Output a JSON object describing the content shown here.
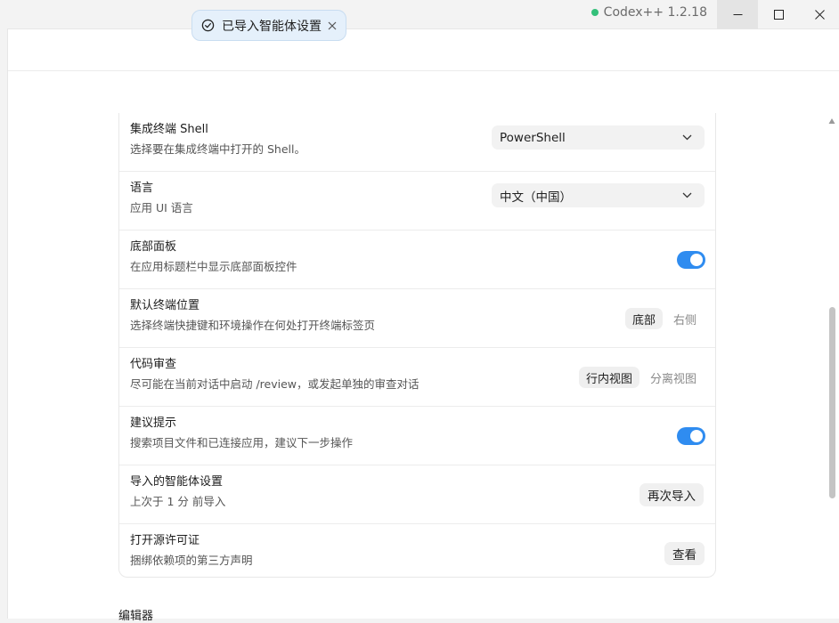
{
  "app": {
    "label": "Codex++ 1.2.18",
    "status_color": "#34c07a"
  },
  "toast": {
    "message": "已导入智能体设置"
  },
  "settings": [
    {
      "title": "集成终端 Shell",
      "description": "选择要在集成终端中打开的 Shell。",
      "control": "select",
      "value": "PowerShell"
    },
    {
      "title": "语言",
      "description": "应用 UI 语言",
      "control": "select",
      "value": "中文（中国）"
    },
    {
      "title": "底部面板",
      "description": "在应用标题栏中显示底部面板控件",
      "control": "toggle",
      "value": true
    },
    {
      "title": "默认终端位置",
      "description": "选择终端快捷键和环境操作在何处打开终端标签页",
      "control": "segmented",
      "options": [
        "底部",
        "右侧"
      ],
      "selected": "底部"
    },
    {
      "title": "代码审查",
      "description": "尽可能在当前对话中启动 /review，或发起单独的审查对话",
      "control": "segmented",
      "options": [
        "行内视图",
        "分离视图"
      ],
      "selected": "行内视图"
    },
    {
      "title": "建议提示",
      "description": "搜索项目文件和已连接应用，建议下一步操作",
      "control": "toggle",
      "value": true
    },
    {
      "title": "导入的智能体设置",
      "description": "上次于 1 分 前导入",
      "control": "button",
      "button_label": "再次导入"
    },
    {
      "title": "打开源许可证",
      "description": "捆绑依赖项的第三方声明",
      "control": "button",
      "button_label": "查看"
    }
  ],
  "next_section_title": "编辑器",
  "colors": {
    "accent": "#2f8cf0",
    "toast_bg": "#e5f0fb"
  }
}
